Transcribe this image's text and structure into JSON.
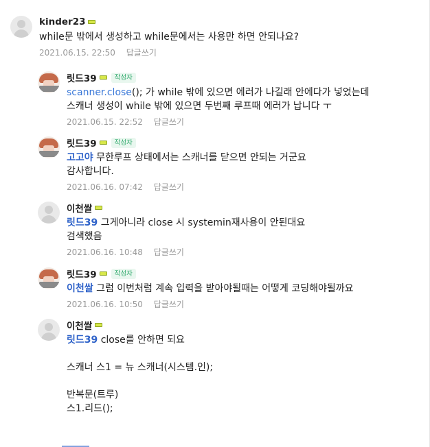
{
  "comments": [
    {
      "name": "kinder23",
      "text": "while문 밖에서 생성하고 while문에서는 사용만 하면 안되나요?",
      "date": "2021.06.15. 22:50",
      "reply": "답글쓰기"
    },
    {
      "name": "릿드39",
      "badge": "작성자",
      "code": "scanner.close",
      "text": "(); 가 while 밖에 있으면 에러가 나길래 안에다가 넣었는데\n스캐너 생성이 while 밖에 있으면 두번째 루프때 에러가 납니다 ㅜ",
      "date": "2021.06.15. 22:52",
      "reply": "답글쓰기"
    },
    {
      "name": "릿드39",
      "badge": "작성자",
      "mention": "고고야",
      "text": " 무한루프 상태에서는 스캐너를 닫으면 안되는 거군요\n감사합니다.",
      "date": "2021.06.16. 07:42",
      "reply": "답글쓰기"
    },
    {
      "name": "이천쌀",
      "mention": "릿드39",
      "text": " 그게아니라 close 시 systemin재사용이 안된대요\n검색했음",
      "date": "2021.06.16. 10:48",
      "reply": "답글쓰기"
    },
    {
      "name": "릿드39",
      "badge": "작성자",
      "mention": "이천쌀",
      "text": " 그럼 이번처럼 계속 입력을 받아야될때는 어떻게 코딩해야될까요",
      "date": "2021.06.16. 10:50",
      "reply": "답글쓰기"
    },
    {
      "name": "이천쌀",
      "mention": "릿드39",
      "text": " close를 안하면 되요\n\n스캐너 스1 = 뉴 스캐너(시스템.인);\n\n반복문(트루)\n스1.리드();"
    }
  ]
}
